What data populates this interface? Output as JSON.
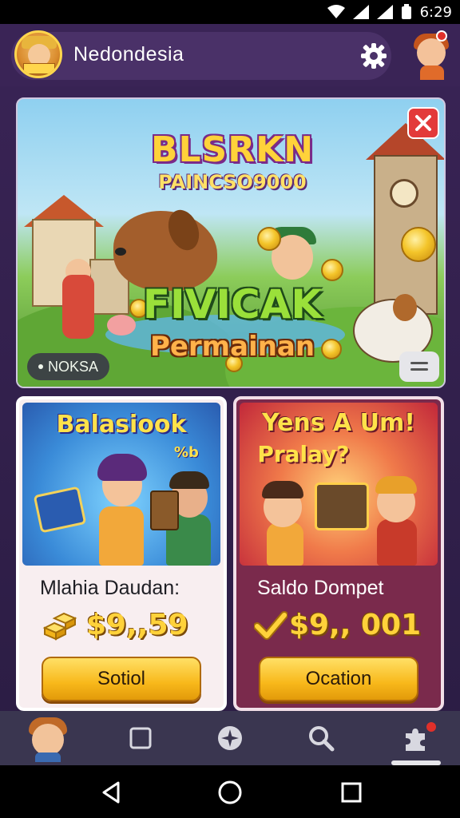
{
  "status_bar": {
    "time": "6:29"
  },
  "header": {
    "title": "Nedondesia",
    "avatar_icon": "player-avatar",
    "settings_icon": "gear-icon",
    "profile_icon": "profile-avatar"
  },
  "hero": {
    "title_line1": "BLSRKN",
    "title_line2": "PAINCSO9000",
    "title_line3": "FIVICAK",
    "title_line4": "Permainan",
    "tag_label": "NOKSA",
    "close_icon": "close-icon",
    "menu_icon": "menu-icon"
  },
  "cards": [
    {
      "image_title": "Balasiook",
      "image_sub": "%b",
      "label": "Mlahia Daudan:",
      "amount": "$9,,59",
      "button_label": "Sotiol",
      "icon": "gold-bars-icon"
    },
    {
      "image_title": "Yens A Um!",
      "image_sub": "Pralay?",
      "label": "Saldo Dompet",
      "amount": "$9,, 001",
      "button_label": "Ocation",
      "icon": "checkmark-icon"
    }
  ],
  "bottom_nav": {
    "items": [
      "avatar",
      "square-icon",
      "compass-icon",
      "search-icon",
      "puzzle-icon"
    ]
  },
  "colors": {
    "background": "#3a2456",
    "accent_gold": "#ffd23a",
    "close_red": "#e33a3a",
    "card_right_bg": "#7a2a4c"
  }
}
